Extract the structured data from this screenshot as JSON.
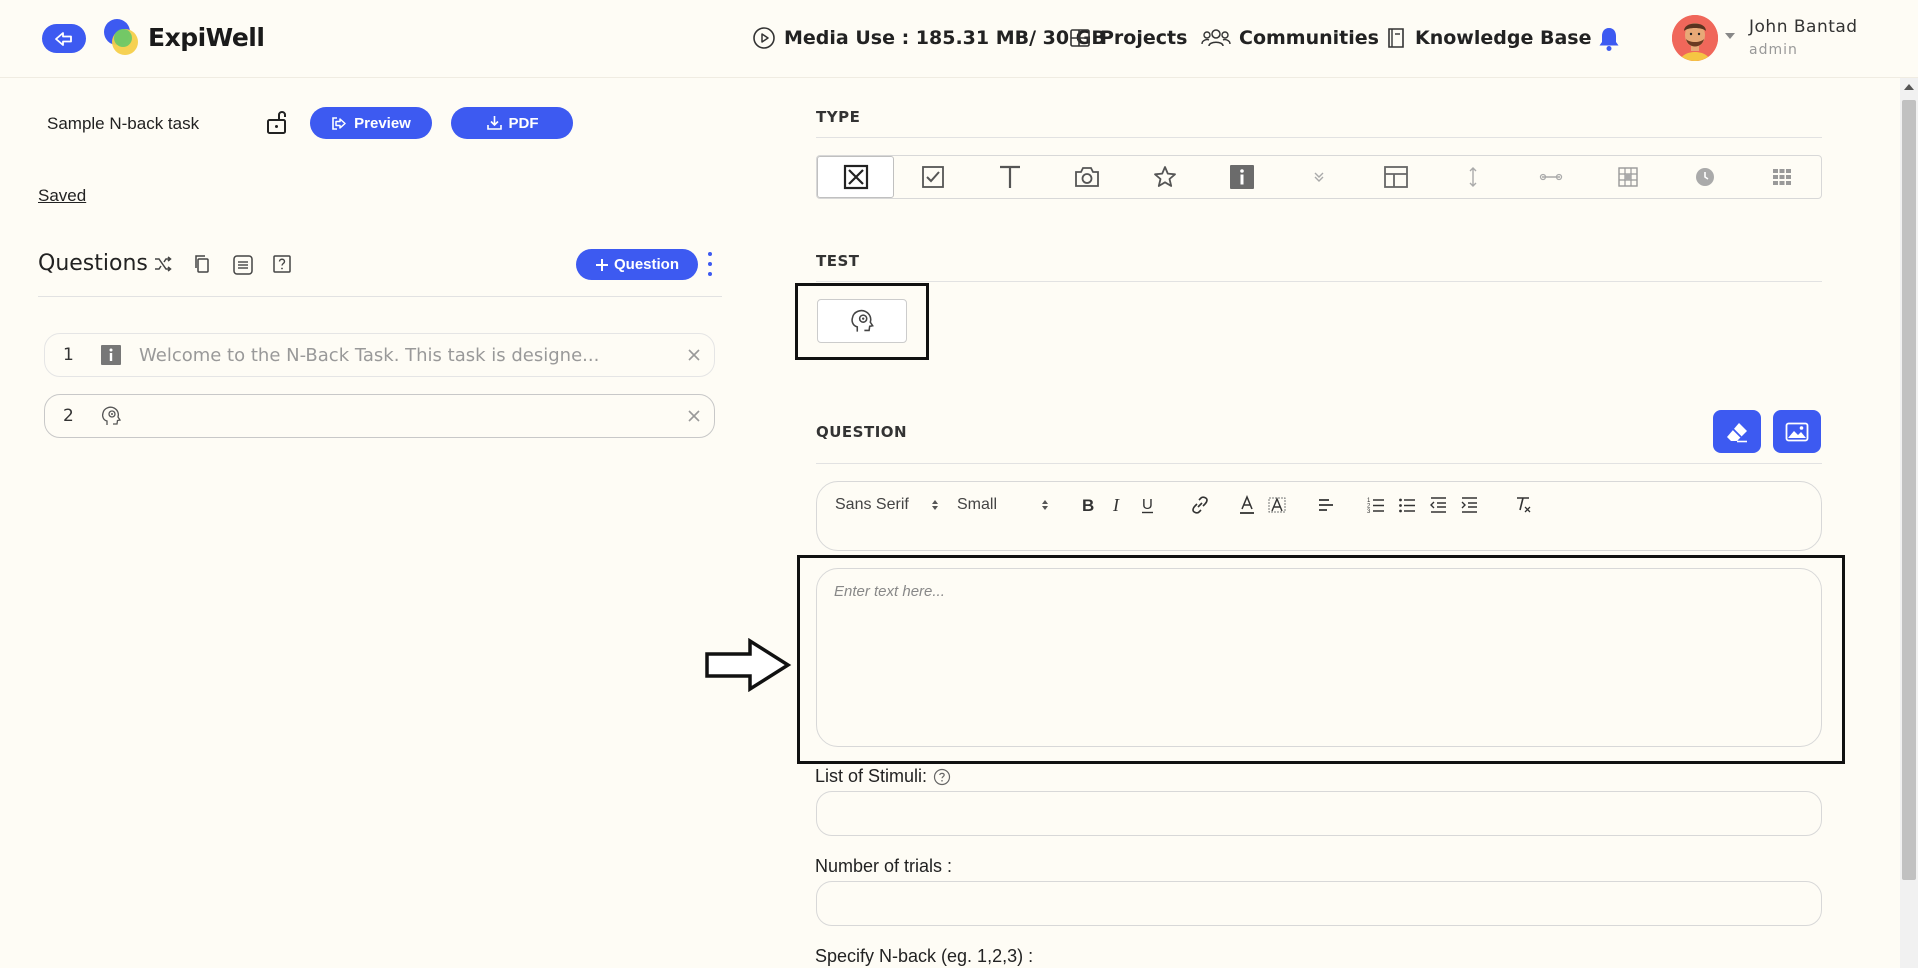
{
  "header": {
    "logo_text": "ExpiWell",
    "media_use": "Media Use : 185.31 MB/ 30 GB",
    "nav_projects": "Projects",
    "nav_communities": "Communities",
    "nav_knowledge": "Knowledge Base",
    "user_name": "John Bantad",
    "user_role": "admin"
  },
  "left": {
    "task_title": "Sample N-back task",
    "preview_label": "Preview",
    "pdf_label": "PDF",
    "saved_label": "Saved",
    "questions_title": "Questions",
    "add_question_label": "Question",
    "questions": [
      {
        "number": "1",
        "icon": "info-icon",
        "text": "Welcome to the N-Back Task. This task is designe..."
      },
      {
        "number": "2",
        "icon": "brain-gear-icon",
        "text": ""
      }
    ]
  },
  "right": {
    "type_label": "TYPE",
    "type_options": [
      "multiple-choice-icon",
      "checkbox-icon",
      "text-icon",
      "camera-icon",
      "star-rating-icon",
      "info-icon",
      "dropdown-icon",
      "layout-icon",
      "vertical-slider-icon",
      "horizontal-slider-icon",
      "grid-icon",
      "clock-icon",
      "matrix-icon"
    ],
    "test_label": "TEST",
    "question_label": "QUESTION",
    "font_select": "Sans Serif",
    "size_select": "Small",
    "editor_placeholder": "Enter text here...",
    "stimuli_label": "List of Stimuli:",
    "trials_label": "Number of trials :",
    "nback_label": "Specify N-back (eg. 1,2,3) :"
  },
  "colors": {
    "accent": "#3d5af1",
    "background": "#fefcf5"
  }
}
